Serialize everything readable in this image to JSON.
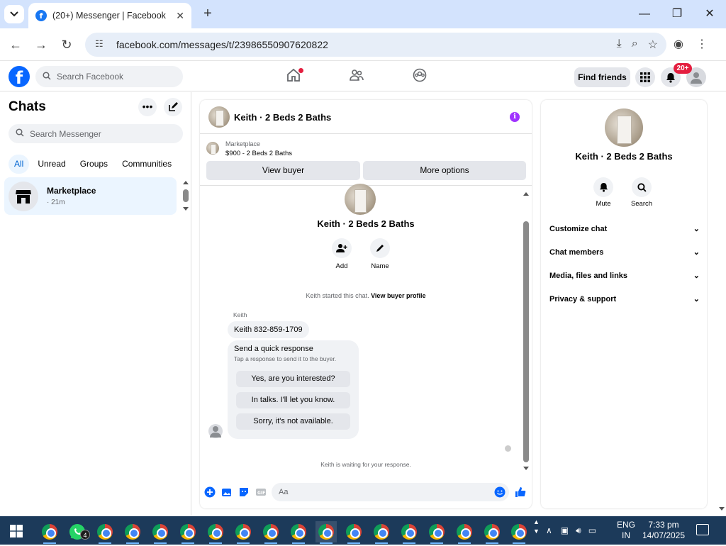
{
  "browser": {
    "tab_title": "(20+) Messenger | Facebook",
    "url": "facebook.com/messages/t/23986550907620822"
  },
  "facebook_header": {
    "search_placeholder": "Search Facebook",
    "find_friends_label": "Find friends",
    "notification_count": "20+"
  },
  "chats_panel": {
    "title": "Chats",
    "search_placeholder": "Search Messenger",
    "filters": [
      "All",
      "Unread",
      "Groups",
      "Communities"
    ],
    "active_filter": "All",
    "items": [
      {
        "name": "Marketplace",
        "time": "· 21m"
      }
    ]
  },
  "conversation": {
    "title": "Keith · 2 Beds 2 Baths",
    "marketplace_label": "Marketplace",
    "listing": "$900 - 2 Beds 2 Baths",
    "view_buyer_label": "View buyer",
    "more_options_label": "More options",
    "profile_name": "Keith · 2 Beds 2 Baths",
    "actions": [
      {
        "label": "Add",
        "icon": "add-person-icon"
      },
      {
        "label": "Name",
        "icon": "pencil-icon"
      }
    ],
    "started_text": "Keith started this chat.",
    "view_buyer_profile": "View buyer profile",
    "sender_name": "Keith",
    "message": "Keith 832-859-1709",
    "quick_response": {
      "title": "Send a quick response",
      "subtitle": "Tap a response to send it to the buyer.",
      "options": [
        "Yes, are you interested?",
        "In talks. I'll let you know.",
        "Sorry, it's not available."
      ]
    },
    "waiting_text": "Keith is waiting for your response.",
    "input_placeholder": "Aa"
  },
  "details_panel": {
    "name": "Keith · 2 Beds 2 Baths",
    "actions": [
      {
        "label": "Mute",
        "icon": "bell-icon"
      },
      {
        "label": "Search",
        "icon": "search-icon"
      }
    ],
    "sections": [
      "Customize chat",
      "Chat members",
      "Media, files and links",
      "Privacy & support"
    ]
  },
  "taskbar": {
    "whatsapp_badge": "4",
    "lang_line1": "ENG",
    "lang_line2": "IN",
    "time": "7:33 pm",
    "date": "14/07/2025"
  },
  "colors": {
    "facebook_blue": "#0866ff",
    "messenger_accent": "#a033ff",
    "chrome_tab_bar": "#d3e3fd",
    "taskbar": "#1c3a5a"
  }
}
